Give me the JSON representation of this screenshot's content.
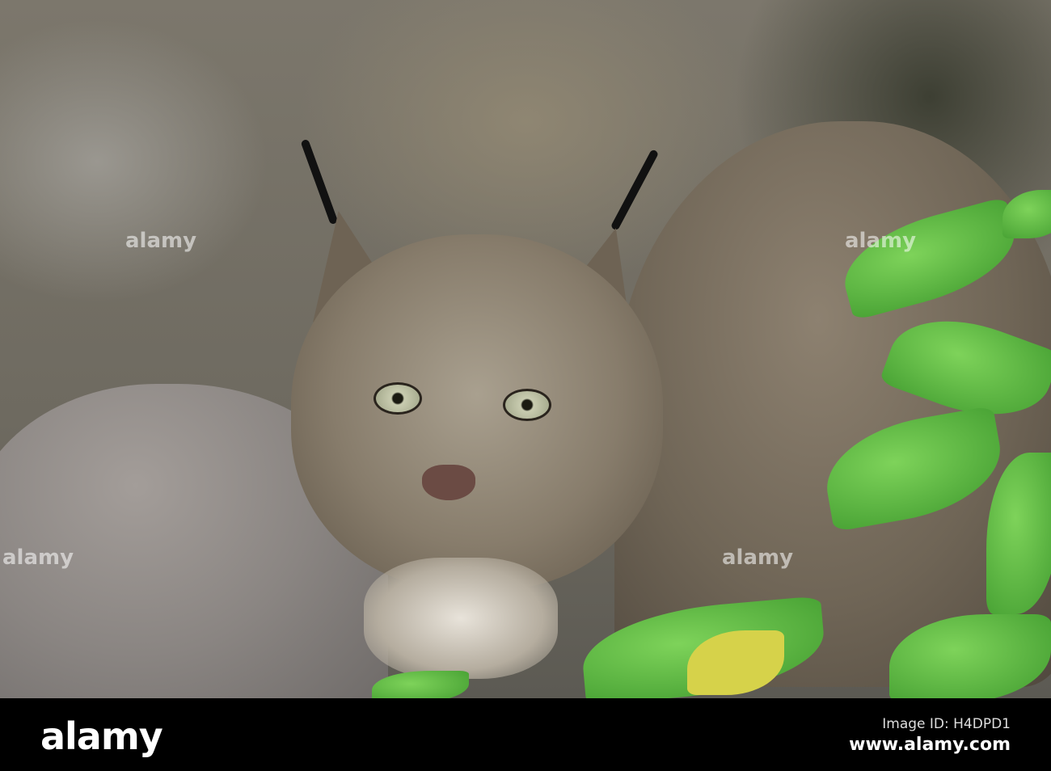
{
  "photo": {
    "subject": "lynx",
    "watermark_text": "alamy"
  },
  "footer": {
    "logo": "alamy",
    "image_id": "Image ID: H4DPD1",
    "website": "www.alamy.com"
  }
}
